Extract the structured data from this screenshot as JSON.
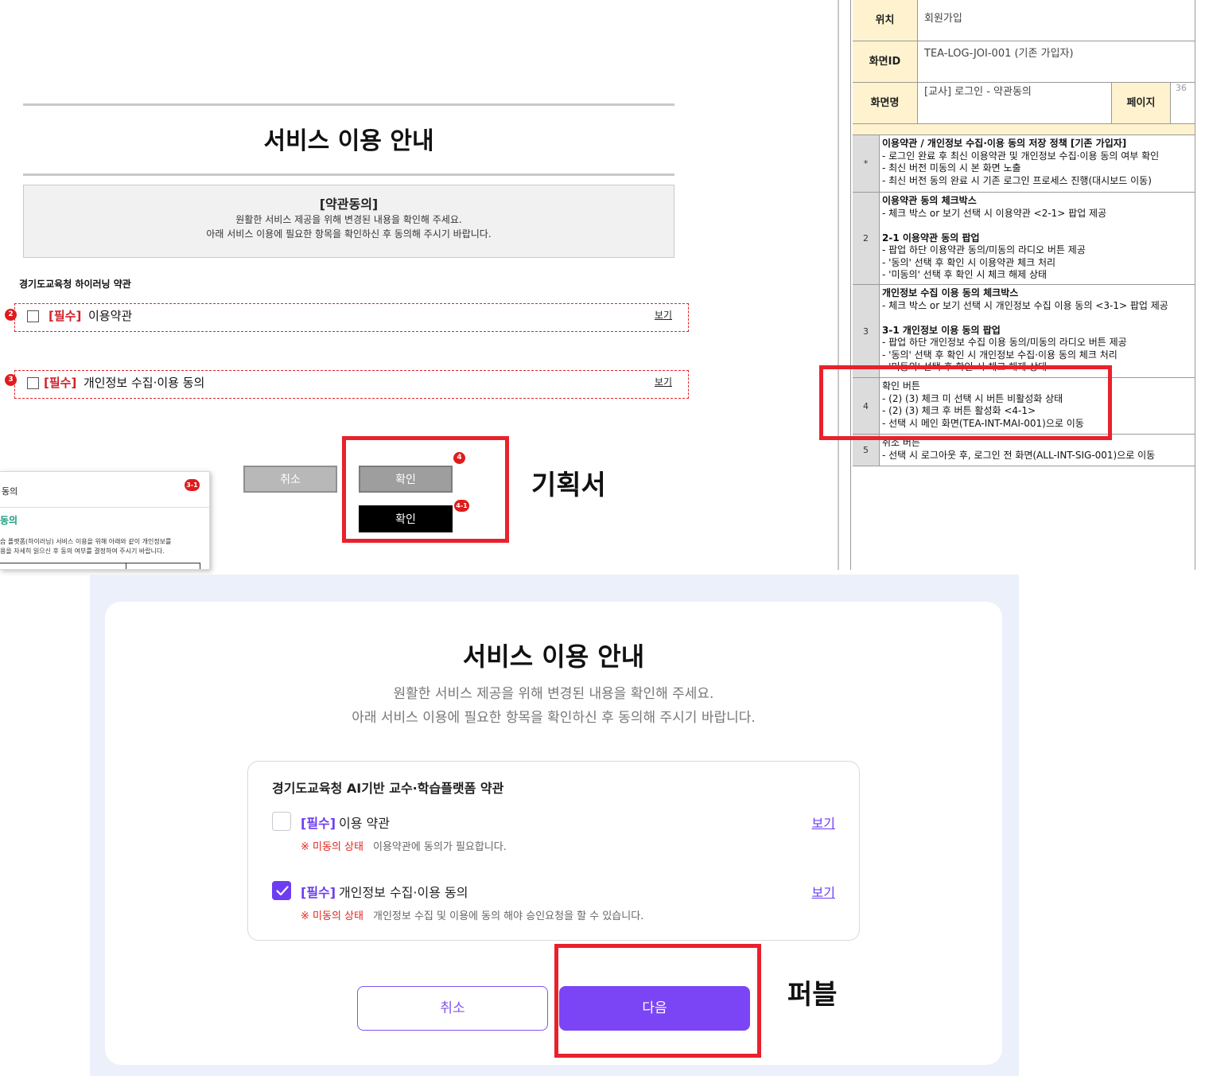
{
  "plan": {
    "title": "서비스 이용 안내",
    "box_heading": "[약관동의]",
    "box_line1": "원활한 서비스 제공을 위해 변경된 내용을 확인해 주세요.",
    "box_line2": "아래 서비스 이용에 필요한 항목을 확인하신 후 동의해 주시기 바랍니다.",
    "terms_heading": "경기도교육청 하이러닝 약관",
    "items": [
      {
        "badge": "2",
        "required": "[필수]",
        "label": "이용약관",
        "view": "보기"
      },
      {
        "badge": "3",
        "required": "[필수]",
        "label": "개인정보 수집·이용 동의",
        "view": "보기"
      }
    ],
    "cancel_label": "취소",
    "confirm_label": "확인",
    "confirm_active_label": "확인",
    "badge_4": "4",
    "badge_4_1": "4-1",
    "annotation": "기획서",
    "popup": {
      "title": "동의",
      "badge": "3-1",
      "subtitle": "동의",
      "line1": "습 플랫폼(하이러닝) 서비스 이용을 위해 아래와 같이 개인정보를",
      "line2": "용을 자세히 읽으신 후 동의 여부를 결정하여 주시기 바랍니다."
    }
  },
  "spec": {
    "location_key": "위치",
    "location_val": "회원가입",
    "screen_id_key": "화면ID",
    "screen_id_val": "TEA-LOG-JOI-001 (기존 가입자)",
    "screen_name_key": "화면명",
    "screen_name_val": "[교사] 로그인 - 약관동의",
    "page_key": "페이지",
    "page_val": "36",
    "rows": [
      {
        "num": "*",
        "lines": [
          "<b>이용약관 / 개인정보 수집·이용 동의 저장 정책 [기존 가입자]</b>",
          "- 로그인 완료 후 최신 이용약관 및 개인정보 수집·이용 동의 여부 확인",
          "- 최신 버전 미동의 시 본 화면 노출",
          "- 최신 버전 동의 완료 시 기존 로그인 프로세스 진행(대시보드 이동)"
        ]
      },
      {
        "num": "2",
        "lines": [
          "<b>이용약관 동의 체크박스</b>",
          "- 체크 박스 or 보기 선택 시 이용약관 <2-1> 팝업 제공",
          "",
          "<b>2-1 이용약관 동의 팝업</b>",
          "- 팝업 하단 이용약관 동의/미동의 라디오 버튼 제공",
          "- '동의' 선택 후 확인 시 이용약관 체크 처리",
          "- '미동의' 선택 후 확인 시 체크 해제 상태"
        ]
      },
      {
        "num": "3",
        "lines": [
          "<b>개인정보 수집 이용 동의 체크박스</b>",
          "- 체크 박스 or 보기 선택 시 개인정보 수집 이용 동의 <3-1> 팝업 제공",
          "",
          "<b>3-1 개인정보 이용 동의 팝업</b>",
          "- 팝업 하단 개인정보 수집 이용 동의/미동의 라디오 버튼 제공",
          "- '동의' 선택 후 확인 시 개인정보 수집·이용 동의 체크 처리",
          "- '미동의' 선택 후 확인 시 체크 해제 상태"
        ]
      },
      {
        "num": "4",
        "lines": [
          "확인 버튼",
          "- (2) (3) 체크 미 선택 시 버튼 비활성화 상태",
          "- (2) (3) 체크 후 버튼 활성화 <4-1>",
          "- 선택 시 메인 화면(TEA-INT-MAI-001)으로 이동"
        ]
      },
      {
        "num": "5",
        "lines": [
          "취소 버튼",
          "- 선택 시 로그아웃 후, 로그인 전 화면(ALL-INT-SIG-001)으로 이동"
        ]
      }
    ]
  },
  "pub": {
    "title": "서비스 이용 안내",
    "desc1": "원활한 서비스 제공을 위해 변경된 내용을 확인해 주세요.",
    "desc2": "아래 서비스 이용에 필요한 항목을 확인하신 후 동의해 주시기 바랍니다.",
    "terms_heading": "경기도교육청 AI기반 교수·학습플랫폼 약관",
    "items": [
      {
        "required": "[필수]",
        "label": "이용 약관",
        "view": "보기",
        "status": "※ 미동의 상태",
        "message": "이용약관에 동의가 필요합니다.",
        "checked": false
      },
      {
        "required": "[필수]",
        "label": "개인정보 수집·이용 동의",
        "view": "보기",
        "status": "※ 미동의 상태",
        "message": "개인정보 수집 및 이용에 동의 해야 승인요청을 할 수 있습니다.",
        "checked": true
      }
    ],
    "cancel_label": "취소",
    "next_label": "다음",
    "annotation": "퍼블"
  },
  "colors": {
    "accent": "#7b45f5",
    "required_red": "#d0212a",
    "highlight_red": "#e9212c",
    "spec_key_bg": "#fff3cf"
  },
  "icons": [
    "checkbox-icon",
    "check-icon"
  ]
}
